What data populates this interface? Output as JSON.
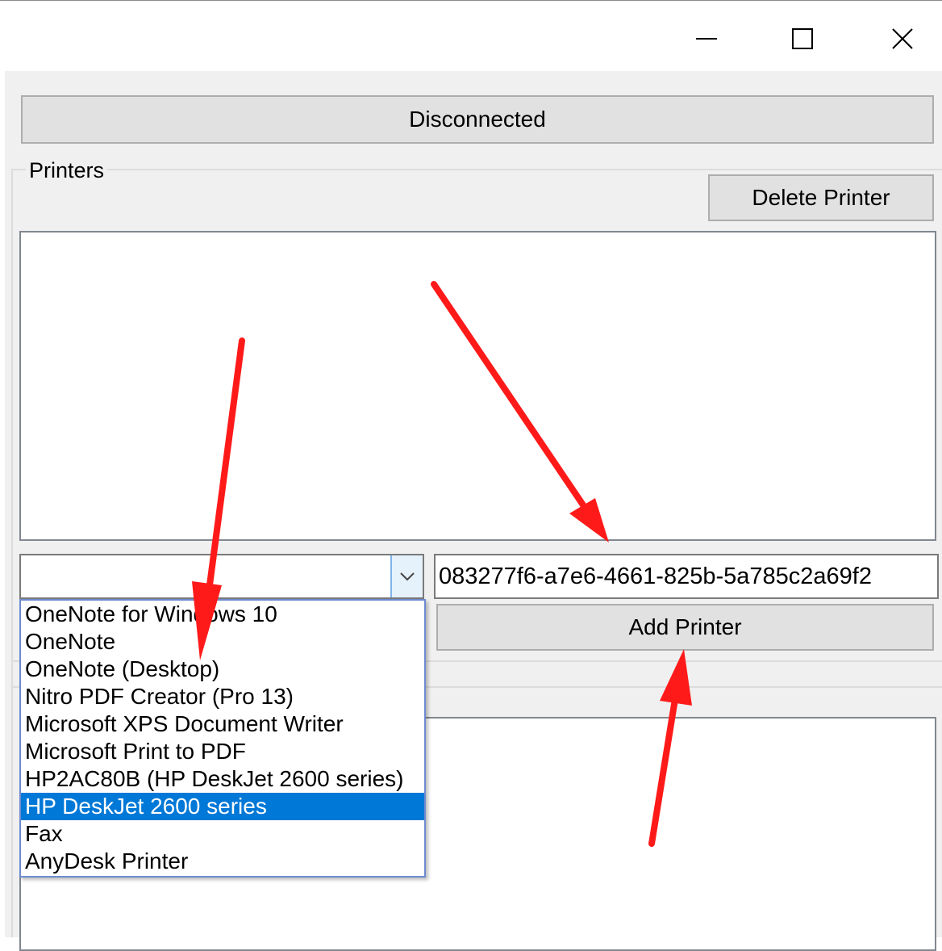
{
  "window": {
    "controls": {
      "minimize_icon": "minimize-icon",
      "maximize_icon": "maximize-icon",
      "close_icon": "close-icon"
    }
  },
  "connection_status_button": "Disconnected",
  "printers_group": {
    "label": "Printers",
    "delete_button": "Delete Printer",
    "add_button": "Add Printer",
    "printer_id_value": "083277f6-a7e6-4661-825b-5a785c2a69f2",
    "combo_value": "",
    "options": [
      "OneNote for Windows 10",
      "OneNote",
      "OneNote (Desktop)",
      "Nitro PDF Creator (Pro 13)",
      "Microsoft XPS Document Writer",
      "Microsoft Print to PDF",
      "HP2AC80B (HP DeskJet 2600 series)",
      "HP DeskJet 2600 series",
      "Fax",
      "AnyDesk Printer"
    ],
    "selected_index": 7
  },
  "colors": {
    "selection": "#0078d7",
    "annotation_arrow": "#ff1a1a"
  }
}
